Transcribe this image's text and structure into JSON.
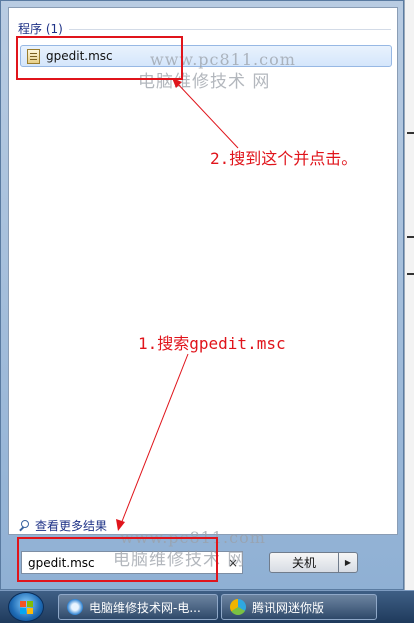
{
  "start_menu": {
    "section_heading": "程序 (1)",
    "result_item_label": "gpedit.msc",
    "see_more_label": "查看更多结果",
    "search_value": "gpedit.msc",
    "search_clear_glyph": "×",
    "shutdown_label": "关机",
    "shutdown_arrow_glyph": "▶"
  },
  "taskbar": {
    "task1_label": "电脑维修技术网-电...",
    "task2_label": "腾讯网迷你版"
  },
  "watermarks": {
    "url_top": "www.pc811.com",
    "name_top": "电脑维修技术 网",
    "url_bottom": "www.pc811.com",
    "name_bottom": "电脑维修技术 网"
  },
  "annotations": {
    "step1": "1.搜索gpedit.msc",
    "step2": "2.搜到这个并点击。",
    "color": "#e0141b"
  },
  "colors": {
    "heading": "#1e3287",
    "highlight": "#d5e6fb",
    "taskbar": "#1f3a5c"
  }
}
